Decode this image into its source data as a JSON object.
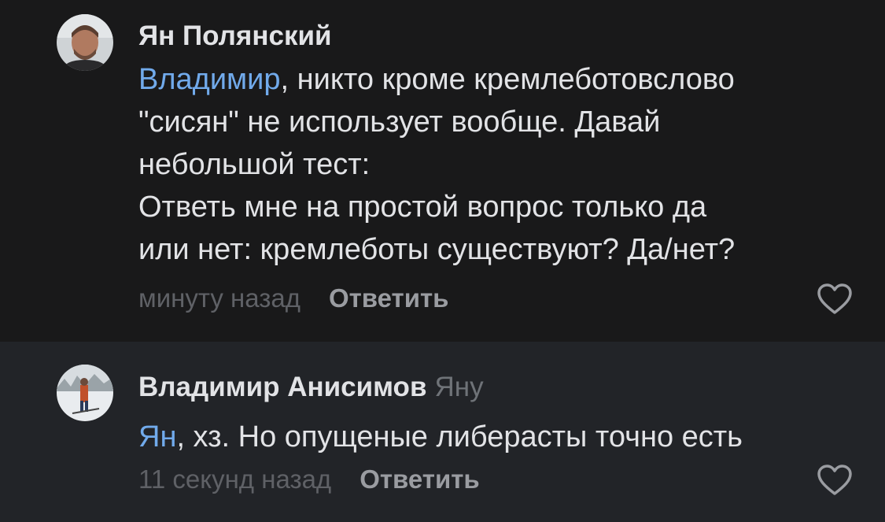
{
  "comments": [
    {
      "author": "Ян Полянский",
      "mention": "Владимир",
      "lines": [
        ", никто кроме кремлеботовслово",
        "\"сисян\" не использует вообще. Давай",
        "небольшой тест:",
        "Ответь мне на простой вопрос только да",
        "или нет: кремлеботы существуют? Да/нет?"
      ],
      "time": "минуту назад",
      "reply_label": "Ответить",
      "avatar_icon": "user-photo-avatar",
      "like_icon": "heart-outline-icon"
    },
    {
      "author": "Владимир Анисимов",
      "reply_to": "Яну",
      "mention": "Ян",
      "lines": [
        ", хз. Но опущеные либерасты точно есть"
      ],
      "time": "11 секунд назад",
      "reply_label": "Ответить",
      "avatar_icon": "user-photo-avatar",
      "like_icon": "heart-outline-icon"
    }
  ],
  "colors": {
    "background_first": "#19191a",
    "background_second": "#222428",
    "text": "#e2e3e6",
    "mention": "#71aaeb",
    "muted": "#5f6166"
  }
}
